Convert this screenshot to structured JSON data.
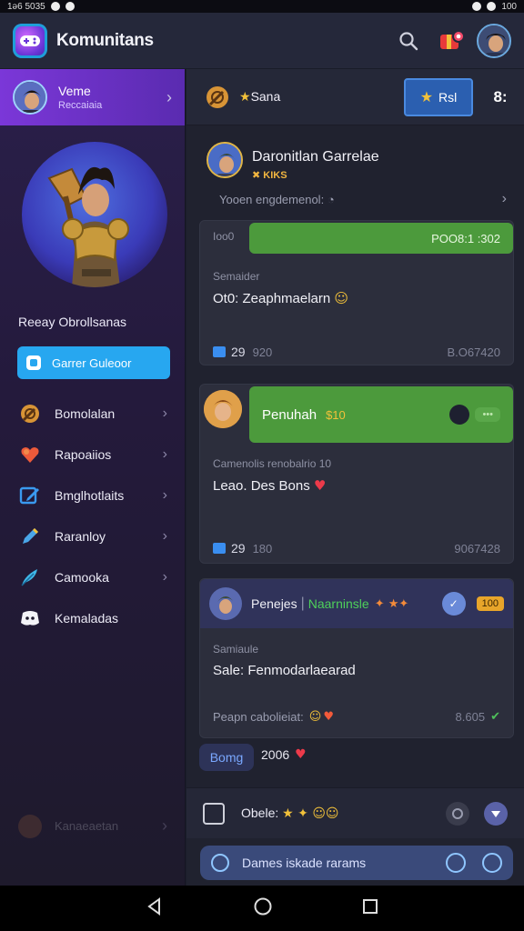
{
  "status_bar": {
    "left": "1ə6 5035",
    "right": "100"
  },
  "app": {
    "title": "Komunitans"
  },
  "sidebar": {
    "profile": {
      "name": "Veme",
      "subtitle": "Reccaiaia"
    },
    "hero_label": "Reeay Obrollsanas",
    "hero_button": "Garrer Guleoor",
    "items": [
      {
        "label": "Bomolalan",
        "icon": "sword-shield-icon"
      },
      {
        "label": "Rapoaiios",
        "icon": "heart-gem-icon"
      },
      {
        "label": "Bmglhotlaits",
        "icon": "edit-icon"
      },
      {
        "label": "Raranloy",
        "icon": "pencil-icon"
      },
      {
        "label": "Camooka",
        "icon": "feather-icon"
      },
      {
        "label": "Kemaladas",
        "icon": "discord-icon"
      }
    ],
    "faded_item": "Kanaeaetan"
  },
  "main": {
    "header": {
      "label": "Sana",
      "post_button": "Rsl",
      "more": "8:"
    },
    "feed_head": {
      "title": "Daronitlan Garrelae",
      "subtitle": "KIKS",
      "note": "Yooen engdemenol:"
    },
    "cards": [
      {
        "pill_left": "Ioo0",
        "pill_right": "POO8:1 :302",
        "meta": "Semaider",
        "text": "Ot0: Zeaphmaelarn",
        "count": "29",
        "secondary": "920",
        "right": "B.O67420"
      },
      {
        "pill_left": "Penuhah",
        "pill_amount": "$10",
        "pill_badge": "•••",
        "meta": "Camenolis renobalrio 10",
        "text": "Leao. Des Bons",
        "count": "29",
        "secondary": "180",
        "right": "9067428"
      },
      {
        "head_name": "Penejes",
        "head_accent": "Naarninsle",
        "head_badge": "100",
        "meta": "Samiaule",
        "text": "Sale: Fenmodarlaearad",
        "foot_left": "Peapn cabolieiat:",
        "foot_right": "8.605"
      }
    ],
    "reply": {
      "label": "Bomg",
      "count": "2006"
    },
    "compose": {
      "label": "Obele:"
    },
    "search": {
      "placeholder": "Dames iskade rarams"
    }
  },
  "colors": {
    "accent": "#7b37d8",
    "button_blue": "#27a7f0",
    "green": "#4c9a3c",
    "background": "#20222f"
  }
}
